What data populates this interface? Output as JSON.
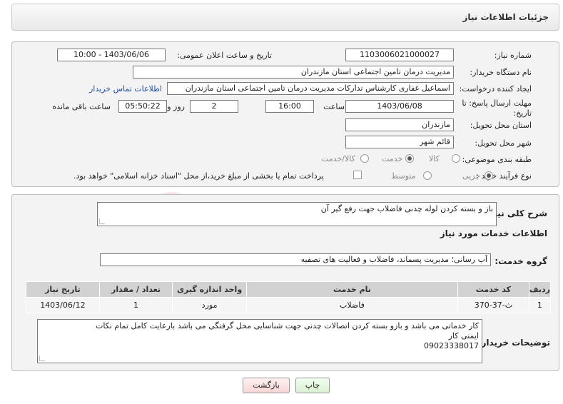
{
  "panel": {
    "title": "جزئیات اطلاعات نیاز"
  },
  "form": {
    "need_number_label": "شماره نیاز:",
    "need_number": "1103006021000027",
    "announce_label": "تاریخ و ساعت اعلان عمومی:",
    "announce_value": "1403/06/06 - 10:00",
    "buyer_org_label": "نام دستگاه خریدار:",
    "buyer_org": "مدیریت درمان تامین اجتماعی استان مازندران",
    "creator_label": "ایجاد کننده درخواست:",
    "creator": "اسماعیل غفاری کارشناس تدارکات مدیریت درمان تامین اجتماعی استان مازندران",
    "contact_link": "اطلاعات تماس خریدار",
    "deadline_label_1": "مهلت ارسال پاسخ: تا",
    "deadline_label_2": "تاریخ:",
    "deadline_date": "1403/06/08",
    "time_label": "ساعت",
    "deadline_time": "16:00",
    "days_value": "2",
    "days_label": "روز و",
    "remaining_time": "05:50:22",
    "remaining_label": "ساعت باقی مانده",
    "province_label": "استان محل تحویل:",
    "province": "مازندران",
    "city_label": "شهر محل تحویل:",
    "city": "قائم شهر",
    "category_label": "طبقه بندی موضوعی:",
    "category_options": [
      "کالا",
      "خدمت",
      "کالا/خدمت"
    ],
    "process_label": "نوع فرآیند خرید :",
    "process_options": [
      "جزیی",
      "متوسط"
    ],
    "payment_note": "پرداخت تمام یا بخشی از مبلغ خرید،از محل \"اسناد خزانه اسلامی\" خواهد بود."
  },
  "summary": {
    "label": "شرح کلی نیاز:",
    "text": "باز و بسته کردن لوله چدنی فاضلاب جهت رفع گیر آن"
  },
  "services": {
    "section_title": "اطلاعات خدمات مورد نیاز",
    "group_label": "گروه خدمت:",
    "group_value": "آب رسانی؛ مدیریت پسماند، فاضلاب و فعالیت های تصفیه",
    "columns": [
      "ردیف",
      "کد خدمت",
      "نام خدمت",
      "واحد اندازه گیری",
      "تعداد / مقدار",
      "تاریخ نیاز"
    ],
    "rows": [
      [
        "1",
        "ث-37-370",
        "فاضلاب",
        "مورد",
        "1",
        "1403/06/12"
      ]
    ]
  },
  "buyer_notes": {
    "label": "توضیحات خریدار:",
    "line1": "کار خدماتی می باشد و بازو بسته کردن اتصالات چدنی جهت شناسایی محل گرفتگی می باشد بارعایت کامل تمام نکات",
    "line2": "ایمنی کار",
    "line3": "09023338017"
  },
  "buttons": {
    "print": "چاپ",
    "back": "بازگشت"
  },
  "watermark": {
    "text": "AriaTender.neT"
  },
  "colors": {
    "link": "#1a4fb5",
    "watermark": "#c0392b"
  }
}
